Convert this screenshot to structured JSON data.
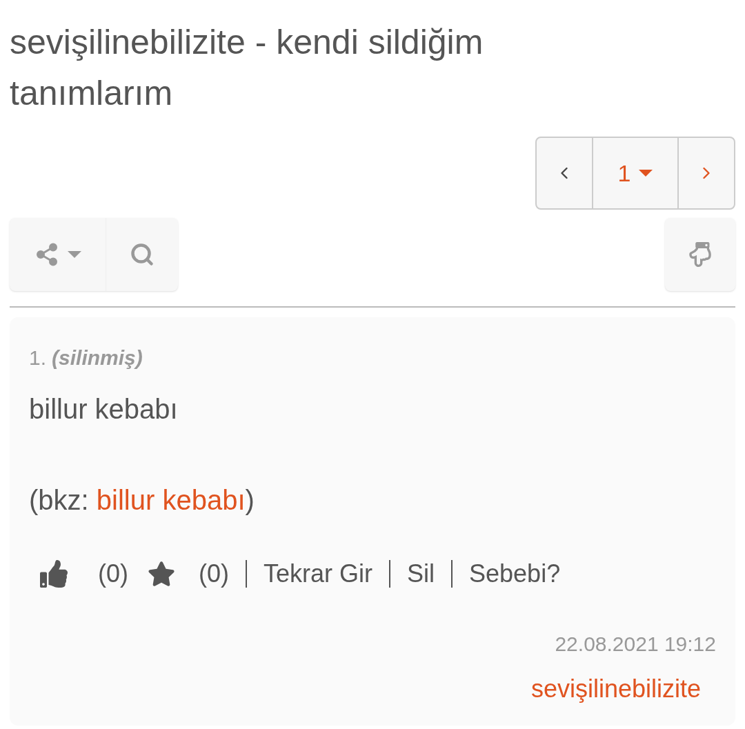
{
  "title": "sevişilinebilizite - kendi sildiğim tanımlarım",
  "pager": {
    "page": "1"
  },
  "entry": {
    "number": "1.",
    "status": "(silinmiş)",
    "text": "billur kebabı",
    "bkz_open": "(bkz: ",
    "bkz_link": "billur kebabı",
    "bkz_close": ")",
    "actions": [
      {
        "kind": "upvote",
        "count": "(0)"
      },
      {
        "kind": "favorite",
        "count": "(0)"
      },
      {
        "kind": "link",
        "label": "Tekrar Gir"
      },
      {
        "kind": "link",
        "label": "Sil"
      },
      {
        "kind": "link",
        "label": "Sebebi?"
      }
    ],
    "date": "22.08.2021 19:12",
    "author": "sevişilinebilizite"
  }
}
